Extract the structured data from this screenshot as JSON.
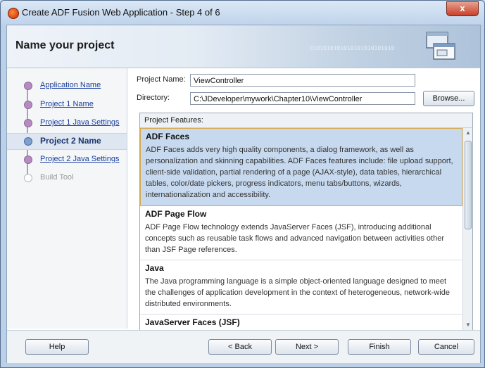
{
  "window": {
    "title": "Create ADF Fusion Web Application - Step 4 of 6",
    "close_label": "x"
  },
  "header": {
    "title": "Name your project",
    "decoration": "0101010101010101010101010"
  },
  "nav": {
    "items": [
      {
        "label": "Application Name",
        "state": "visited"
      },
      {
        "label": "Project 1 Name",
        "state": "visited"
      },
      {
        "label": "Project 1 Java Settings",
        "state": "visited"
      },
      {
        "label": "Project 2 Name",
        "state": "current"
      },
      {
        "label": "Project 2 Java Settings",
        "state": "visited"
      },
      {
        "label": "Build Tool",
        "state": "disabled"
      }
    ]
  },
  "form": {
    "project_name_label": "Project Name:",
    "project_name_value": "ViewController",
    "directory_label": "Directory:",
    "directory_value": "C:\\JDeveloper\\mywork\\Chapter10\\ViewController",
    "browse_label": "Browse..."
  },
  "features": {
    "header": "Project Features:",
    "items": [
      {
        "title": "ADF Faces",
        "description": "ADF Faces adds very high quality components, a dialog framework, as well as personalization and skinning capabilities. ADF Faces features include: file upload support, client-side validation, partial rendering of a page (AJAX-style), data tables, hierarchical tables, color/date pickers, progress indicators, menu tabs/buttons, wizards, internationalization and accessibility."
      },
      {
        "title": "ADF Page Flow",
        "description": "ADF Page Flow technology extends JavaServer Faces (JSF), introducing additional concepts such as reusable task flows and advanced navigation between activities other than JSF Page references."
      },
      {
        "title": "Java",
        "description": "The Java programming language is a simple object-oriented language designed to meet the challenges of application development in the context of heterogeneous, network-wide distributed environments."
      },
      {
        "title": "JavaServer Faces (JSF)",
        "description": ""
      }
    ]
  },
  "footer": {
    "help": "Help",
    "back": "< Back",
    "next": "Next >",
    "finish": "Finish",
    "cancel": "Cancel"
  },
  "colors": {
    "accent": "#1a3f9c",
    "selection": "#c7d9ee",
    "selection_border": "#d8a84a"
  }
}
